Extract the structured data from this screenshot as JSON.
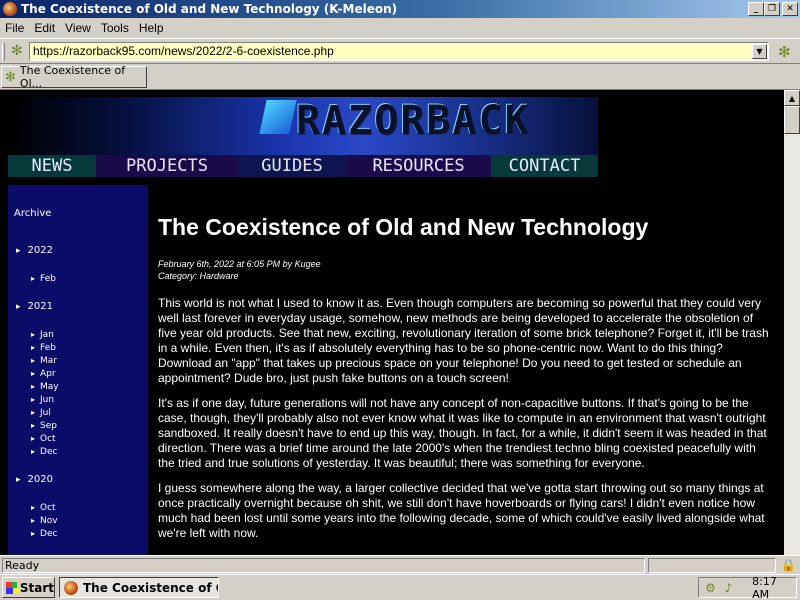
{
  "window": {
    "title": "The Coexistence of Old and New Technology (K-Meleon)"
  },
  "menu": {
    "items": [
      "File",
      "Edit",
      "View",
      "Tools",
      "Help"
    ]
  },
  "address": {
    "url": "https://razorback95.com/news/2022/2-6-coexistence.php"
  },
  "tab": {
    "label": "The Coexistence of Ol..."
  },
  "site": {
    "logo": "RAZORBACK",
    "nav": [
      "NEWS",
      "PROJECTS",
      "GUIDES",
      "RESOURCES",
      "CONTACT"
    ]
  },
  "sidebar": {
    "heading": "Archive",
    "years": [
      {
        "year": "2022",
        "months": [
          "Feb"
        ]
      },
      {
        "year": "2021",
        "months": [
          "Jan",
          "Feb",
          "Mar",
          "Apr",
          "May",
          "Jun",
          "Jul",
          "Sep",
          "Oct",
          "Dec"
        ]
      },
      {
        "year": "2020",
        "months": [
          "Oct",
          "Nov",
          "Dec"
        ]
      }
    ]
  },
  "article": {
    "title": "The Coexistence of Old and New Technology",
    "date": "February 6th, 2022 at 6:05 PM by Kugee",
    "category": "Category: Hardware",
    "paragraphs": [
      "This world is not what I used to know it as. Even though computers are becoming so powerful that they could very well last forever in everyday usage, somehow, new methods are being developed to accelerate the obsoletion of five year old products. See that new, exciting, revolutionary iteration of some brick telephone? Forget it, it'll be trash in a while. Even then, it's as if absolutely everything has to be so phone-centric now. Want to do this thing? Download an \"app\" that takes up precious space on your telephone! Do you need to get tested or schedule an appointment? Dude bro, just push fake buttons on a touch screen!",
      "It's as if one day, future generations will not have any concept of non-capacitive buttons. If that's going to be the case, though, they'll probably also not ever know what it was like to compute in an environment that wasn't outright sandboxed. It really doesn't have to end up this way, though. In fact, for a while, it didn't seem it was headed in that direction. There was a brief time around the late 2000's when the trendiest techno bling coexisted peacefully with the tried and true solutions of yesterday. It was beautiful; there was something for everyone.",
      "I guess somewhere along the way, a larger collective decided that we've gotta start throwing out so many things at once practically overnight because oh shit, we still don't have hoverboards or flying cars! I didn't even notice how much had been lost until some years into the following decade, some of which could've easily lived alongside what we're left with now."
    ]
  },
  "status": {
    "text": "Ready"
  },
  "taskbar": {
    "start": "Start",
    "task": "The Coexistence of Ol...",
    "clock": "8:17 AM"
  }
}
